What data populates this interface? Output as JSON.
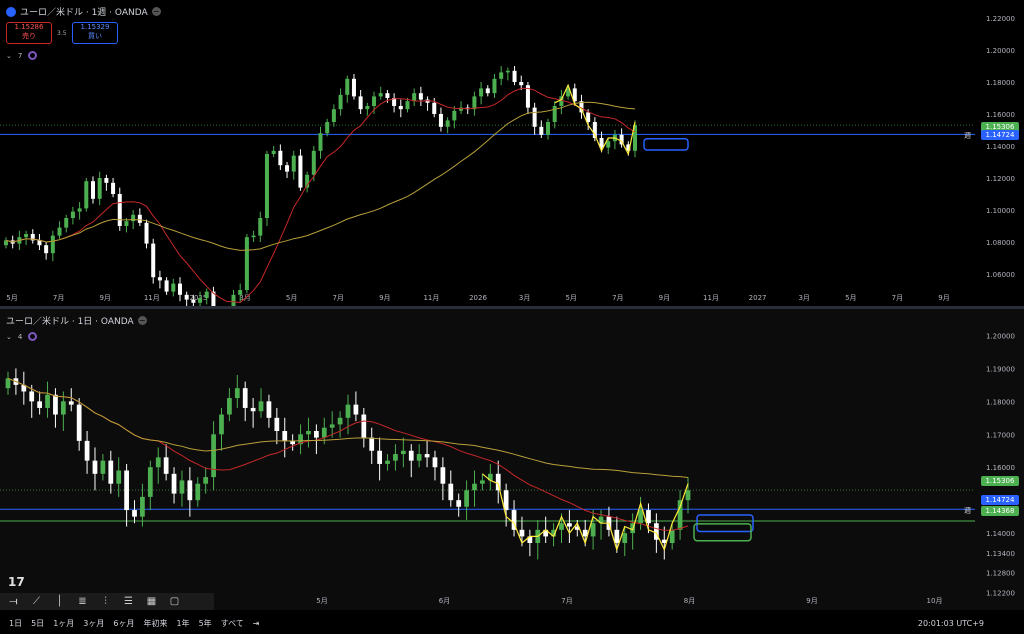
{
  "top": {
    "title": "ユーロ／米ドル · 1週 · OANDA",
    "sell_price": "1.15286",
    "sell_label": "売り",
    "buy_price": "1.15329",
    "buy_label": "買い",
    "spread": "3.5",
    "indicator_count": "7",
    "last_price_tag": "1.15306",
    "hline_tag": "1.14724",
    "hline_label": "週",
    "y_ticks": [
      "1.22000",
      "1.20000",
      "1.18000",
      "1.16000",
      "1.14000",
      "1.12000",
      "1.10000",
      "1.08000",
      "1.06000"
    ],
    "x_ticks": [
      "5月",
      "7月",
      "9月",
      "11月",
      "2025",
      "3月",
      "5月",
      "7月",
      "9月",
      "11月",
      "2026",
      "3月",
      "5月",
      "7月",
      "9月",
      "11月",
      "2027",
      "3月",
      "5月",
      "7月",
      "9月"
    ]
  },
  "bottom": {
    "title": "ユーロ／米ドル · 1日 · OANDA",
    "indicator_count": "4",
    "last_price_tag": "1.15306",
    "hline_tag": "1.14724",
    "hline2_tag": "1.14368",
    "hline_label": "週",
    "y_ticks": [
      "1.20000",
      "1.19000",
      "1.18000",
      "1.17000",
      "1.16000",
      "1.15000",
      "1.14000",
      "1.13400",
      "1.12800",
      "1.12200"
    ],
    "x_ticks": [
      "5月",
      "6月",
      "7月",
      "8月",
      "9月",
      "10月"
    ]
  },
  "timeframes": [
    "1日",
    "5日",
    "1ヶ月",
    "3ヶ月",
    "6ヶ月",
    "年初来",
    "1年",
    "5年",
    "すべて"
  ],
  "clock": "20:01:03 UTC+9",
  "colors": {
    "up": "#4caf50",
    "down": "#ffffff",
    "ma_fast": "#c62828",
    "ma_slow": "#b8a03a",
    "hline": "#2962ff",
    "hline2": "#4caf50",
    "zigzag": "#ffeb3b"
  },
  "chart_data": [
    {
      "type": "candlestick",
      "title": "ユーロ／米ドル · 1週 · OANDA",
      "ylim": [
        1.05,
        1.225
      ],
      "y_unit": "EUR/USD",
      "horizontal_line": 1.14724,
      "last_price": 1.15306,
      "closes": [
        1.081,
        1.079,
        1.083,
        1.085,
        1.081,
        1.078,
        1.073,
        1.084,
        1.089,
        1.095,
        1.099,
        1.101,
        1.118,
        1.107,
        1.12,
        1.117,
        1.11,
        1.09,
        1.093,
        1.097,
        1.092,
        1.079,
        1.058,
        1.056,
        1.049,
        1.054,
        1.047,
        1.044,
        1.042,
        1.045,
        1.049,
        1.036,
        1.029,
        1.033,
        1.047,
        1.05,
        1.083,
        1.084,
        1.095,
        1.135,
        1.137,
        1.128,
        1.124,
        1.134,
        1.114,
        1.122,
        1.137,
        1.148,
        1.155,
        1.163,
        1.172,
        1.182,
        1.171,
        1.163,
        1.165,
        1.171,
        1.173,
        1.17,
        1.165,
        1.163,
        1.168,
        1.173,
        1.169,
        1.167,
        1.16,
        1.152,
        1.156,
        1.162,
        1.164,
        1.163,
        1.171,
        1.176,
        1.173,
        1.182,
        1.186,
        1.187,
        1.18,
        1.178,
        1.164,
        1.152,
        1.147,
        1.155,
        1.165,
        1.171,
        1.176,
        1.168,
        1.161,
        1.155,
        1.145,
        1.139,
        1.143,
        1.147,
        1.141,
        1.137,
        1.153
      ],
      "ma_fast_label": "red moving average",
      "ma_slow_label": "gold moving average"
    },
    {
      "type": "candlestick",
      "title": "ユーロ／米ドル · 1日 · OANDA",
      "ylim": [
        1.12,
        1.205
      ],
      "horizontal_lines": [
        1.14724,
        1.14368
      ],
      "last_price": 1.15306,
      "closes": [
        1.187,
        1.185,
        1.183,
        1.18,
        1.178,
        1.182,
        1.176,
        1.18,
        1.179,
        1.168,
        1.162,
        1.158,
        1.162,
        1.155,
        1.159,
        1.147,
        1.145,
        1.151,
        1.16,
        1.163,
        1.158,
        1.152,
        1.156,
        1.15,
        1.155,
        1.157,
        1.17,
        1.176,
        1.181,
        1.184,
        1.178,
        1.177,
        1.18,
        1.175,
        1.171,
        1.168,
        1.167,
        1.17,
        1.171,
        1.169,
        1.172,
        1.173,
        1.175,
        1.179,
        1.176,
        1.169,
        1.165,
        1.161,
        1.162,
        1.164,
        1.165,
        1.162,
        1.164,
        1.163,
        1.16,
        1.155,
        1.15,
        1.148,
        1.153,
        1.155,
        1.156,
        1.158,
        1.153,
        1.147,
        1.141,
        1.139,
        1.137,
        1.141,
        1.139,
        1.141,
        1.143,
        1.142,
        1.141,
        1.139,
        1.143,
        1.145,
        1.141,
        1.137,
        1.14,
        1.143,
        1.147,
        1.143,
        1.138,
        1.137,
        1.141,
        1.15,
        1.153
      ]
    }
  ]
}
